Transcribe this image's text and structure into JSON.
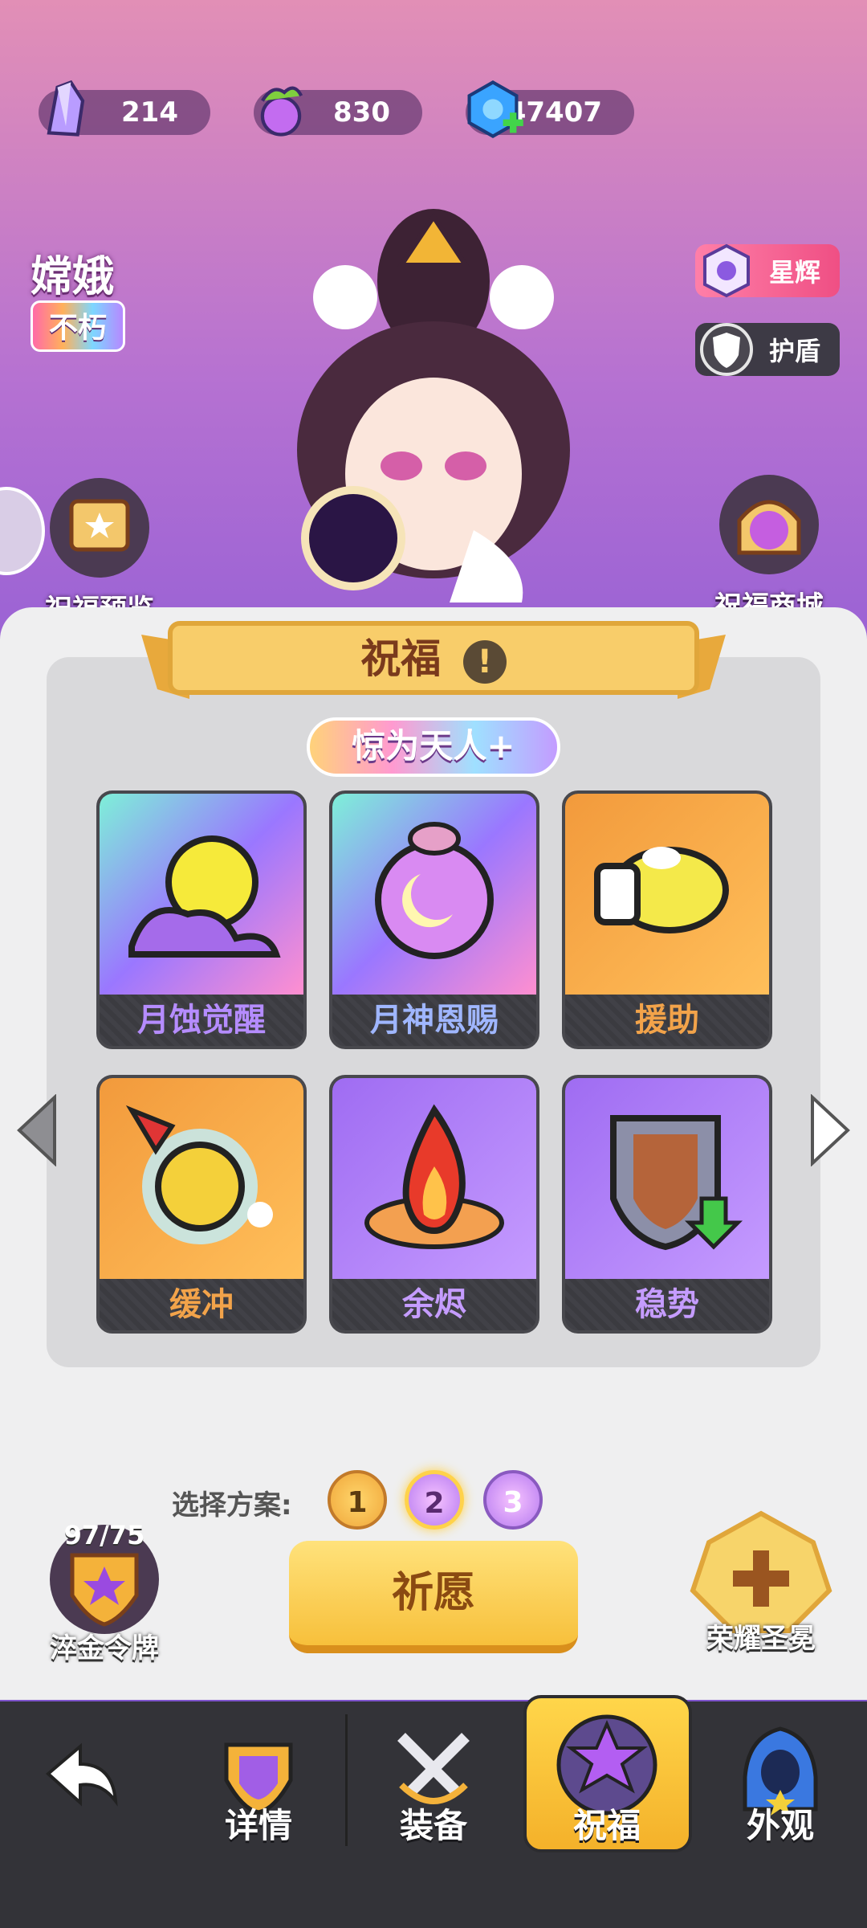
{
  "currencies": [
    {
      "name": "crystal-icon",
      "value": "214"
    },
    {
      "name": "potion-icon",
      "value": "830"
    },
    {
      "name": "gem-plus-icon",
      "value": "47407"
    }
  ],
  "hero": {
    "name": "嫦娥",
    "tag": "不朽"
  },
  "right_pills": {
    "star": "星辉",
    "shield": "护盾"
  },
  "side": {
    "preview": "祝福预览",
    "shop": "祝福商城"
  },
  "panel": {
    "title": "祝福",
    "subtitle": "惊为天人+"
  },
  "blessings": [
    {
      "label": "月蚀觉醒",
      "style": "rainbow",
      "icon": "eclipse-icon"
    },
    {
      "label": "月神恩赐",
      "style": "rainbow",
      "icon": "moon-orb-icon"
    },
    {
      "label": "援助",
      "style": "orange",
      "icon": "help-glove-icon"
    },
    {
      "label": "缓冲",
      "style": "orange",
      "icon": "buffer-face-icon"
    },
    {
      "label": "余烬",
      "style": "purple",
      "icon": "fire-icon"
    },
    {
      "label": "稳势",
      "style": "purple",
      "icon": "shield-down-icon"
    }
  ],
  "plans": {
    "label": "选择方案:",
    "options": [
      "1",
      "2",
      "3"
    ],
    "selected": "2"
  },
  "medal": {
    "count": "97/75",
    "label": "淬金令牌"
  },
  "wish_button": "祈愿",
  "crown": {
    "label": "荣耀圣冕"
  },
  "nav": [
    {
      "label": "",
      "icon": "back-arrow-icon"
    },
    {
      "label": "详情",
      "icon": "helmet-icon"
    },
    {
      "label": "装备",
      "icon": "swords-icon"
    },
    {
      "label": "祝福",
      "icon": "star-blessing-icon"
    },
    {
      "label": "外观",
      "icon": "hood-icon"
    }
  ]
}
